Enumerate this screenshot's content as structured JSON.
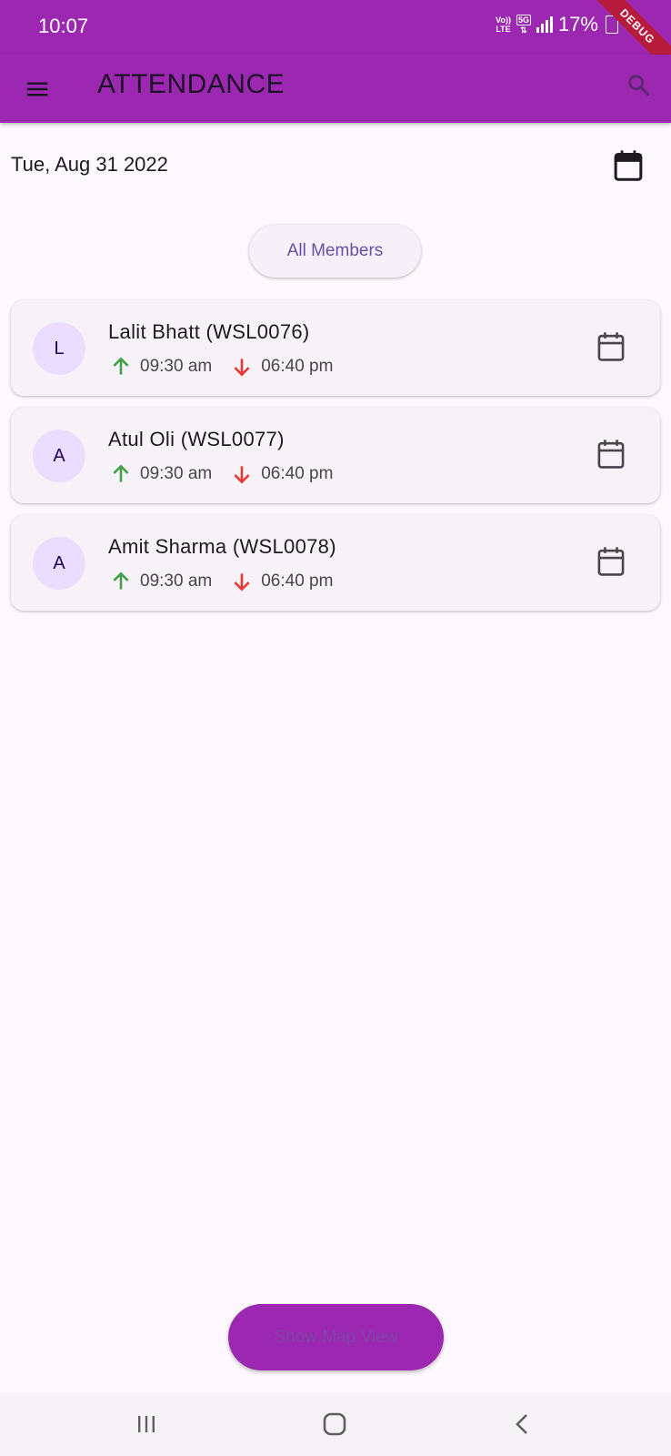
{
  "status_bar": {
    "time": "10:07",
    "net_top": "Vo))",
    "net_bottom": "LTE",
    "net_5g": "5G",
    "battery": "17%",
    "debug_label": "DEBUG"
  },
  "app_bar": {
    "title": "ATTENDANCE",
    "menu_icon": "menu-icon",
    "search_icon": "search-icon",
    "color": "#9c27b0"
  },
  "date_header": {
    "date": "Tue, Aug 31 2022",
    "icon": "calendar-icon"
  },
  "filter": {
    "label": "All Members"
  },
  "members": [
    {
      "initial": "L",
      "name": "Lalit Bhatt (WSL0076)",
      "in_time": "09:30 am",
      "out_time": "06:40 pm"
    },
    {
      "initial": "A",
      "name": "Atul Oli (WSL0077)",
      "in_time": "09:30 am",
      "out_time": "06:40 pm"
    },
    {
      "initial": "A",
      "name": "Amit Sharma (WSL0078)",
      "in_time": "09:30 am",
      "out_time": "06:40 pm"
    }
  ],
  "colors": {
    "in_arrow": "#43a047",
    "out_arrow": "#e53935",
    "accent": "#9c27b0"
  },
  "footer": {
    "map_button_label": "Show Map View"
  },
  "nav_bar": {
    "recent_icon": "recent-apps-icon",
    "home_icon": "home-icon",
    "back_icon": "back-icon"
  }
}
